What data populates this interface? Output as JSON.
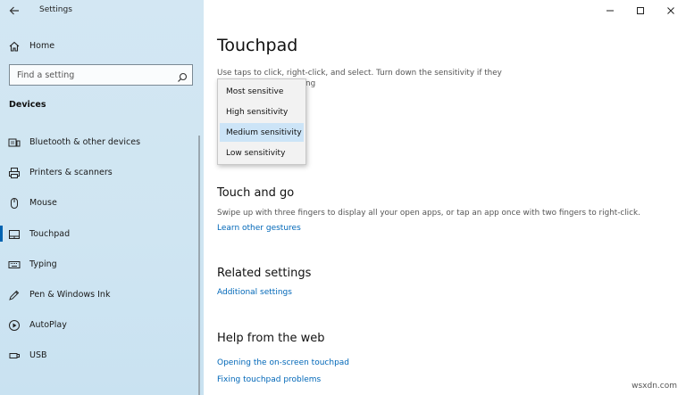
{
  "window": {
    "title": "Settings"
  },
  "sidebar": {
    "home_label": "Home",
    "search_placeholder": "Find a setting",
    "section": "Devices",
    "items": [
      {
        "label": "Bluetooth & other devices",
        "icon": "bluetooth-devices-icon"
      },
      {
        "label": "Printers & scanners",
        "icon": "printer-icon"
      },
      {
        "label": "Mouse",
        "icon": "mouse-icon"
      },
      {
        "label": "Touchpad",
        "icon": "touchpad-icon",
        "active": true
      },
      {
        "label": "Typing",
        "icon": "keyboard-icon"
      },
      {
        "label": "Pen & Windows Ink",
        "icon": "pen-icon"
      },
      {
        "label": "AutoPlay",
        "icon": "autoplay-icon"
      },
      {
        "label": "USB",
        "icon": "usb-icon"
      }
    ]
  },
  "main": {
    "title": "Touchpad",
    "desc_line1": "Use taps to click, right-click, and select. Turn down the sensitivity if they",
    "desc_line2_visible": "ping",
    "dropdown": {
      "options": [
        "Most sensitive",
        "High sensitivity",
        "Medium sensitivity",
        "Low sensitivity"
      ],
      "selected": "Medium sensitivity"
    },
    "touch_and_go": {
      "heading": "Touch and go",
      "text": "Swipe up with three fingers to display all your open apps, or tap an app once with two fingers to right-click.",
      "link": "Learn other gestures"
    },
    "related": {
      "heading": "Related settings",
      "link": "Additional settings"
    },
    "help": {
      "heading": "Help from the web",
      "links": [
        "Opening the on-screen touchpad",
        "Fixing touchpad problems"
      ]
    }
  },
  "watermark": "wsxdn.com",
  "colors": {
    "accent": "#0067b8",
    "sidebar_bg": "#d3e7f3",
    "selected_bg": "#cce4f7"
  }
}
